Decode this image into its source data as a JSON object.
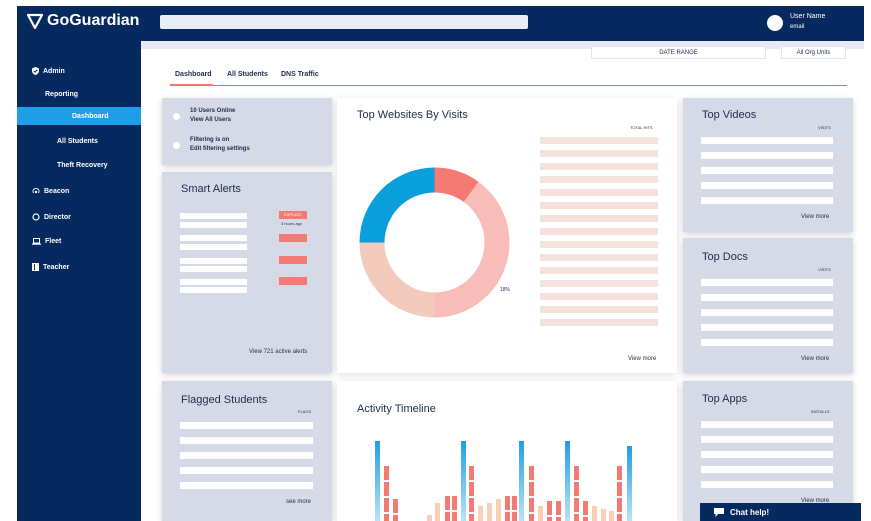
{
  "header": {
    "brand": "GoGuardian",
    "user_name": "User Name",
    "user_email": "email"
  },
  "filters": {
    "date_range": "DATE RANGE",
    "org_units": "All Org Units"
  },
  "sidebar": {
    "admin": "Admin",
    "reporting": "Reporting",
    "dashboard": "Dashboard",
    "all_students": "All Students",
    "theft_recovery": "Theft Recovery",
    "beacon": "Beacon",
    "director": "Director",
    "fleet": "Fleet",
    "teacher": "Teacher"
  },
  "tabs": [
    "Dashboard",
    "All Students",
    "DNS Traffic"
  ],
  "status": {
    "users_online": "10 Users Online",
    "view_all_users": "View All Users",
    "filtering_on": "Filtering is on",
    "edit_filtering": "Edit filtering settings"
  },
  "smart_alerts": {
    "title": "Smart Alerts",
    "badge": "EXPLICIT",
    "badge_time": "3 hours ago",
    "footer": "View 721 active alerts"
  },
  "top_websites": {
    "title": "Top Websites By Visits",
    "column": "TOTAL HITS",
    "percent_label": "18%",
    "footer": "View more"
  },
  "top_videos": {
    "title": "Top Videos",
    "column": "VISITS",
    "footer": "View more"
  },
  "top_docs": {
    "title": "Top Docs",
    "column": "VISITS",
    "footer": "View more"
  },
  "flagged_students": {
    "title": "Flagged Students",
    "column": "FLAGS",
    "footer": "see more"
  },
  "activity": {
    "title": "Activity Timeline"
  },
  "top_apps": {
    "title": "Top Apps",
    "column": "INSTALLS",
    "footer": "View more"
  },
  "chat": {
    "label": "Chat help!"
  },
  "colors": {
    "navy": "#062a5f",
    "accent_blue": "#1f9ee8",
    "coral": "#f47a74",
    "peach": "#f5e2dc",
    "teal": "#20c0b0"
  },
  "chart_data": {
    "type": "pie",
    "title": "Top Websites By Visits",
    "slices": [
      {
        "value": 10,
        "color": "#f47a74"
      },
      {
        "value": 40,
        "color": "#f8bdb8"
      },
      {
        "value": 25,
        "color": "#f2cbbd"
      },
      {
        "value": 25,
        "color": "#0a9edb"
      }
    ],
    "labels": [
      "18%"
    ]
  }
}
